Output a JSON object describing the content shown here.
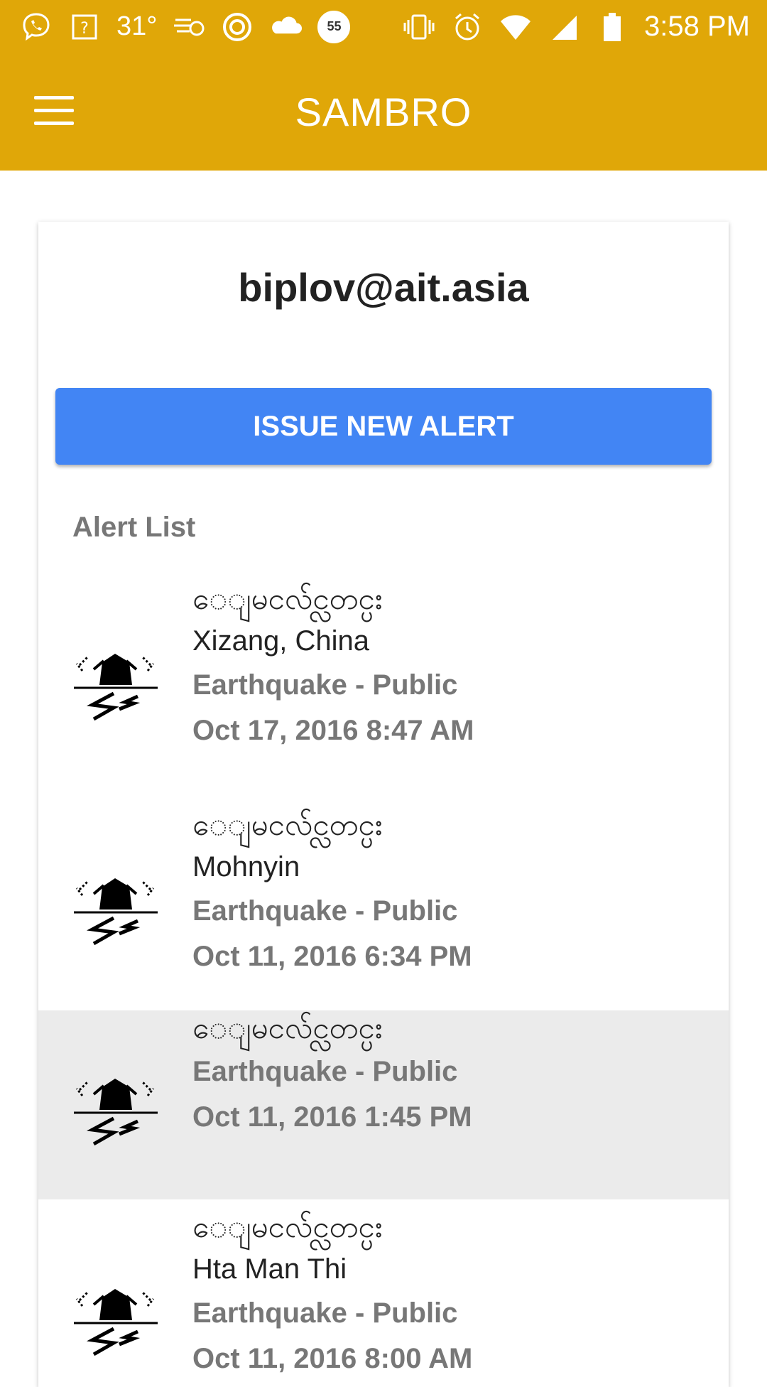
{
  "status_bar": {
    "temperature": "31°",
    "notification_badge": "55",
    "time": "3:58 PM",
    "icons": [
      "viber-icon",
      "sim-card-icon",
      "temperature-icon",
      "weather-icon",
      "target-icon",
      "cloud-icon",
      "bag-badge-icon",
      "vibrate-icon",
      "alarm-icon",
      "wifi-icon",
      "signal-icon",
      "battery-icon"
    ]
  },
  "app_bar": {
    "title": "SAMBRO",
    "menu_icon": "hamburger-menu-icon"
  },
  "user": {
    "email": "biplov@ait.asia"
  },
  "actions": {
    "issue_alert_label": "ISSUE NEW ALERT"
  },
  "alert_list": {
    "heading": "Alert List",
    "items": [
      {
        "title": "ေျမငလ်င္လတင္ပး",
        "area": "Xizang, China",
        "event": "Earthquake - Public",
        "date": "Oct 17, 2016 8:47 AM",
        "icon": "earthquake-icon",
        "selected": false
      },
      {
        "title": "ေျမငလ်င္လတင္ပး",
        "area": "Mohnyin",
        "event": "Earthquake - Public",
        "date": "Oct 11, 2016 6:34 PM",
        "icon": "earthquake-icon",
        "selected": false
      },
      {
        "title": "ေျမငလ်င္လတင္ပး",
        "area": "",
        "event": "Earthquake - Public",
        "date": "Oct 11, 2016 1:45 PM",
        "icon": "earthquake-icon",
        "selected": true
      },
      {
        "title": "ေျမငလ်င္လတင္ပး",
        "area": "Hta Man Thi",
        "event": "Earthquake - Public",
        "date": "Oct 11, 2016 8:00 AM",
        "icon": "earthquake-icon",
        "selected": false
      }
    ]
  },
  "colors": {
    "app_bar": "#e0a708",
    "primary_button": "#4285f4",
    "selected_row": "#ebebeb",
    "secondary_text": "#777777"
  }
}
